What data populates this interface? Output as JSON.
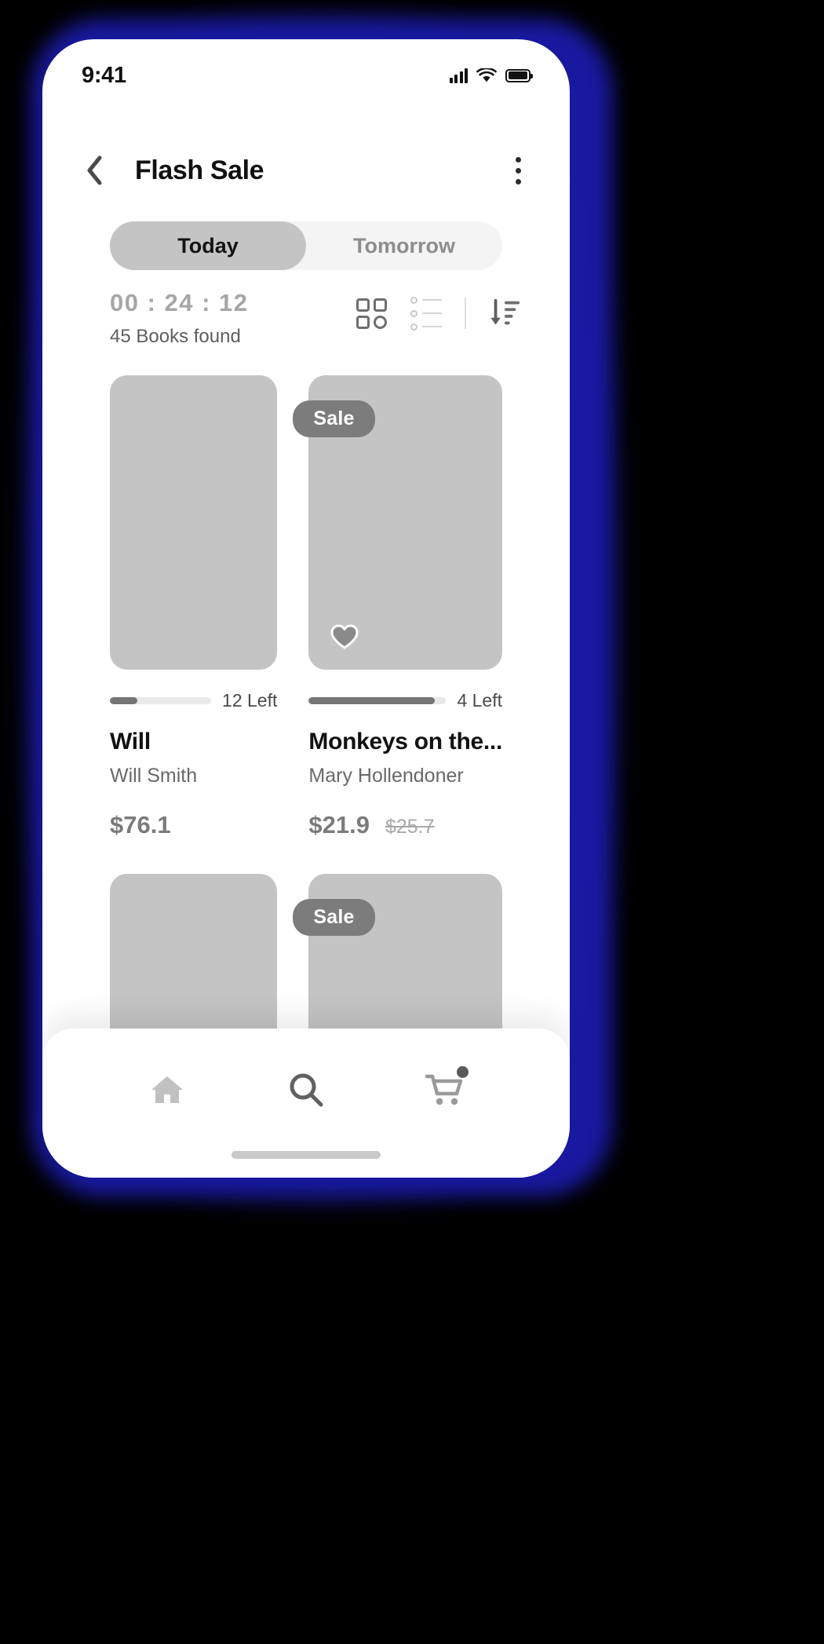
{
  "status_bar": {
    "time": "9:41",
    "signal_icon": "cellular-signal-icon",
    "wifi_icon": "wifi-icon",
    "battery_icon": "battery-icon"
  },
  "app_bar": {
    "back_icon": "chevron-left-icon",
    "title": "Flash Sale",
    "more_icon": "more-vertical-icon"
  },
  "tabs": [
    {
      "label": "Today",
      "active": true
    },
    {
      "label": "Tomorrow",
      "active": false
    }
  ],
  "timer": {
    "value": "00 : 24 : 12",
    "subtitle": "45 Books found"
  },
  "view_tools": [
    {
      "name": "grid-view-icon",
      "label": "Grid view"
    },
    {
      "name": "list-view-icon",
      "label": "List view"
    },
    {
      "name": "sort-descending-icon",
      "label": "Sort"
    }
  ],
  "products": [
    {
      "title": "Will",
      "author": "Will Smith",
      "price": "$76.1",
      "old_price": "",
      "stock_text": "12 Left",
      "stock_percent": 27,
      "sale_badge": "",
      "favorite": false
    },
    {
      "title": "Monkeys on the...",
      "author": "Mary Hollendoner",
      "price": "$21.9",
      "old_price": "$25.7",
      "stock_text": "4 Left",
      "stock_percent": 92,
      "sale_badge": "Sale",
      "favorite": true
    },
    {
      "title": "",
      "author": "",
      "price": "",
      "old_price": "",
      "stock_text": "",
      "stock_percent": 0,
      "sale_badge": "",
      "favorite": false
    },
    {
      "title": "",
      "author": "",
      "price": "",
      "old_price": "",
      "stock_text": "",
      "stock_percent": 0,
      "sale_badge": "Sale",
      "favorite": false
    }
  ],
  "bottom_nav": [
    {
      "name": "home-icon",
      "label": "Home",
      "active": false
    },
    {
      "name": "search-icon",
      "label": "Search",
      "active": true
    },
    {
      "name": "cart-icon",
      "label": "Cart",
      "active": false,
      "badge": true
    }
  ],
  "colors": {
    "glow": "#1a1aa8",
    "placeholder": "#c4c4c4",
    "badge": "#7c7c7c",
    "active_tab": "#c4c4c4",
    "track": "#f4f4f4"
  }
}
